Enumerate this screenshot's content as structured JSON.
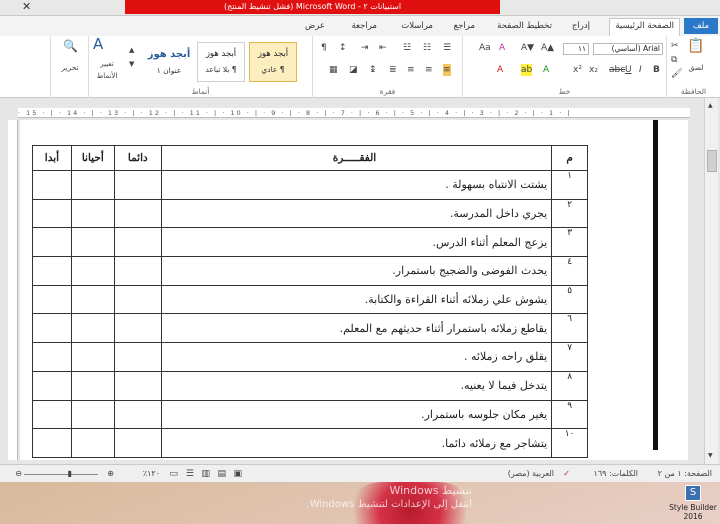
{
  "titlebar": {
    "title": "استبيانات ٢ - Microsoft Word (فشل تنشيط المنتج)",
    "close": "✕"
  },
  "tabs": {
    "file": "ملف",
    "home": "الصفحة الرئيسية",
    "insert": "إدراج",
    "page_layout": "تخطيط الصفحة",
    "references": "مراجع",
    "mailings": "مراسلات",
    "review": "مراجعة",
    "view": "عرض"
  },
  "ribbon": {
    "clipboard": {
      "paste": "لصق",
      "label": "الحافظة"
    },
    "font": {
      "name": "Arial (أساسي)",
      "size": "١١",
      "label": "خط"
    },
    "paragraph": {
      "label": "فقرة"
    },
    "styles": {
      "label": "أنماط",
      "items": [
        {
          "sample": "أبجد هوز",
          "name": "¶ عادي"
        },
        {
          "sample": "أبجد هوز",
          "name": "¶ بلا تباعد"
        },
        {
          "sample": "أبجد هوز",
          "name": "عنوان ١"
        }
      ],
      "change_styles": "تغيير الأنماط"
    },
    "editing": {
      "label": "تحرير"
    }
  },
  "ruler": {
    "marks": "· 15 · | · 14 · | · 13 · | · 12 · | · 11 · | · 10 · | · 9 · | · 8 · | · 7 · | · 6 · | · 5 · | · 4 · | · 3 · | · 2 · | · 1 · |"
  },
  "table": {
    "headers": {
      "num": "م",
      "item": "الفقـــــرة",
      "always": "دائما",
      "sometimes": "أحيانا",
      "never": "أبدا"
    },
    "rows": [
      {
        "num": "١",
        "text": "يشتت الانتباه بسهولة ."
      },
      {
        "num": "٢",
        "text": "يجري داخل المدرسة."
      },
      {
        "num": "٣",
        "text": "يزعج المعلم أثناء الدرس."
      },
      {
        "num": "٤",
        "text": "يحدث الفوضى والضجيج باستمرار."
      },
      {
        "num": "٥",
        "text": "يشوش علي زملائه أثناء القراءة والكتابة."
      },
      {
        "num": "٦",
        "text": "يقاطع زملائه باستمرار أثناء حديثهم مع المعلم."
      },
      {
        "num": "٧",
        "text": "يقلق راحه زملائه ."
      },
      {
        "num": "٨",
        "text": "يتدخل فيما لا يعنيه."
      },
      {
        "num": "٩",
        "text": "يغير مكان جلوسه باستمرار."
      },
      {
        "num": "١٠",
        "text": "يتشاجر مع زملائه دائما."
      }
    ]
  },
  "statusbar": {
    "page": "الصفحة: ١ من ٢",
    "words": "الكلمات: ١٦٩",
    "language": "العربية (مصر)",
    "zoom": "١٢٠٪"
  },
  "watermark": {
    "line1": "تنشيط Windows",
    "line2": "انتقل إلى الإعدادات لتنشيط Windows."
  },
  "stylebuilder": {
    "label": "Style Builder",
    "version": "2016"
  }
}
